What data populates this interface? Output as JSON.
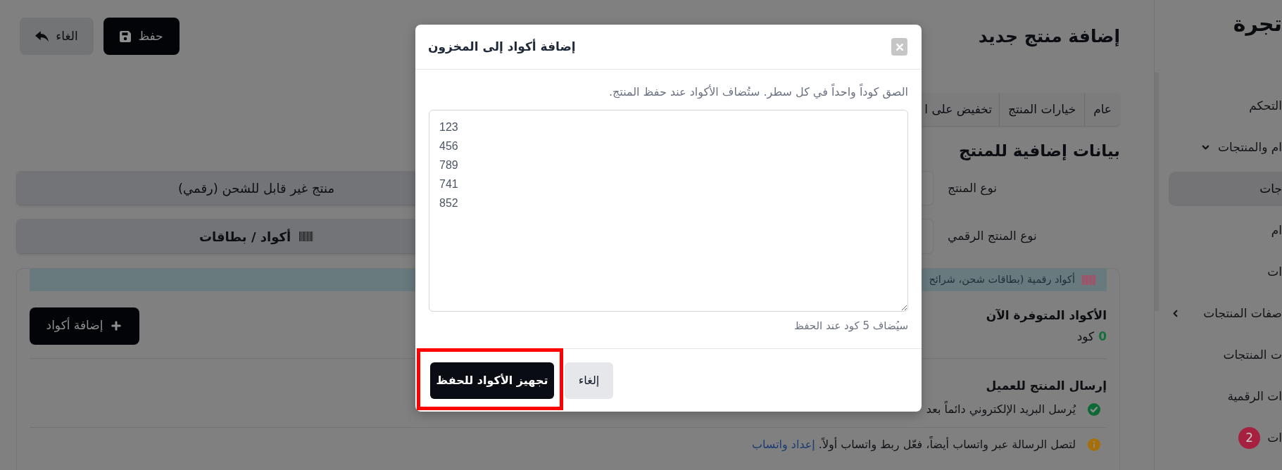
{
  "sidebar": {
    "brand": "تجرة",
    "items": [
      {
        "kind": "link",
        "label": "التحكم",
        "selected": false
      },
      {
        "kind": "group",
        "label": "ام والمنتجات",
        "expanded": true,
        "selected": false
      },
      {
        "kind": "link",
        "label": "جات",
        "selected": true
      },
      {
        "kind": "link",
        "label": "ام",
        "selected": false
      },
      {
        "kind": "link",
        "label": "ات",
        "selected": false
      },
      {
        "kind": "group",
        "label": "صفات المنتجات",
        "expanded": false,
        "selected": false
      },
      {
        "kind": "link",
        "label": "ت المنتجات",
        "selected": false
      },
      {
        "kind": "link",
        "label": "ات الرقمية",
        "selected": false
      },
      {
        "kind": "link",
        "label": "ات",
        "badge": "2",
        "selected": false
      }
    ]
  },
  "header": {
    "title": "إضافة منتج جديد",
    "actions": [
      {
        "kind": "save",
        "label": "حفظ"
      },
      {
        "kind": "cancel",
        "label": "الغاء"
      }
    ]
  },
  "tabs": [
    {
      "label": "عام"
    },
    {
      "label": "خيارات المنتج"
    },
    {
      "label": "تخفيض على ا"
    }
  ],
  "section": {
    "title": "بيانات إضافية للمنتج",
    "fields": [
      {
        "kind": "plain",
        "label": "نوع المنتج",
        "option": {
          "label": "منتج غير قابل للشحن (رقمي)",
          "selected": true
        }
      },
      {
        "kind": "codes",
        "label": "نوع المنتج الرقمي",
        "option": {
          "label": "أكواد / بطاقات",
          "selected": true
        }
      }
    ]
  },
  "codes_card": {
    "notice": "أكواد رقمية (بطاقات شحن، شرائح",
    "add_button": "إضافة أكواد",
    "available": {
      "title": "الأكواد المتوفرة الآن",
      "count": "0",
      "unit": "كود"
    },
    "delivery": {
      "title": "إرسال المنتج للعميل",
      "notes": [
        {
          "kind": "success",
          "text": "يُرسل البريد الإلكتروني دائماً بعد"
        },
        {
          "kind": "info",
          "text": "لتصل الرسالة عبر واتساب أيضاً، فعّل ربط واتساب أولاً.",
          "link": "إعداد واتساب"
        }
      ]
    }
  },
  "modal": {
    "title": "إضافة أكواد إلى المخزون",
    "description": "الصق كوداً واحداً في كل سطر. ستُضاف الأكواد عند حفظ المنتج.",
    "textarea": {
      "value": "123\n456\n789\n741\n852"
    },
    "hint": "سيُضاف 5 كود عند الحفظ",
    "buttons": [
      {
        "kind": "secondary",
        "label": "إلغاء",
        "highlighted": false
      },
      {
        "kind": "primary",
        "label": "تجهيز الأكواد للحفظ",
        "highlighted": true
      }
    ]
  }
}
